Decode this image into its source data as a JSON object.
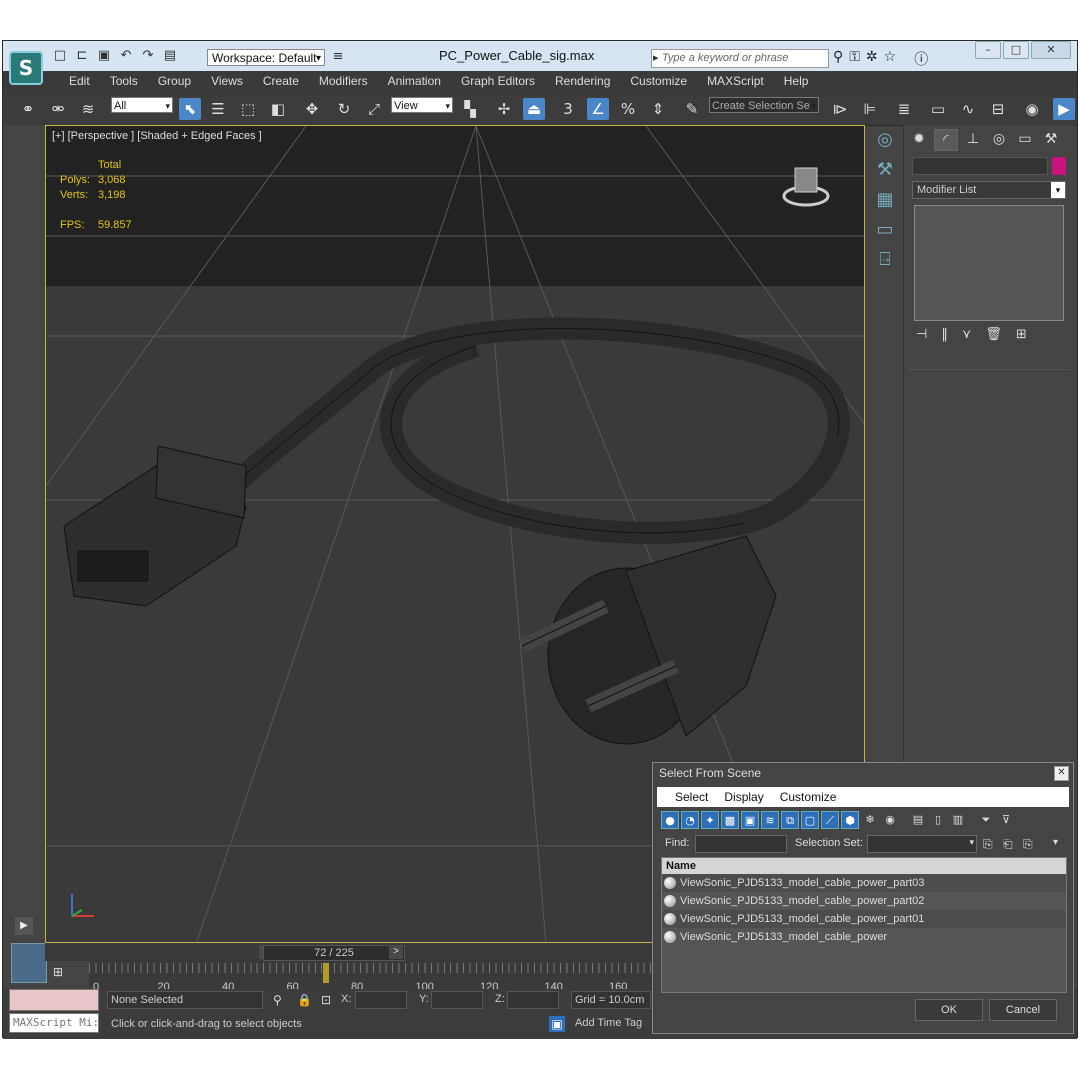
{
  "app": {
    "title": "PC_Power_Cable_sig.max",
    "workspace": "Workspace: Default",
    "search_placeholder": "Type a keyword or phrase",
    "logo_icon": "3dsmax-logo-icon"
  },
  "menu": [
    "Edit",
    "Tools",
    "Group",
    "Views",
    "Create",
    "Modifiers",
    "Animation",
    "Graph Editors",
    "Rendering",
    "Customize",
    "MAXScript",
    "Help"
  ],
  "toolbar": {
    "filter_value": "All",
    "ref_coord_value": "View",
    "named_selection_value": "Create Selection Se",
    "snap_label": "3",
    "angle_snap_label": "%"
  },
  "viewport": {
    "label": "[+] [Perspective ] [Shaded + Edged Faces ]",
    "stats": {
      "header": "Total",
      "polys_label": "Polys:",
      "polys": "3,068",
      "verts_label": "Verts:",
      "verts": "3,198",
      "fps_label": "FPS:",
      "fps": "59.857"
    }
  },
  "command_panel": {
    "modifier_list": "Modifier List",
    "color_swatch": "#c6147f"
  },
  "timeline": {
    "frame": "72 / 225",
    "ticks": [
      "0",
      "20",
      "40",
      "60",
      "80",
      "100",
      "120",
      "140",
      "160"
    ],
    "current_fraction": 0.32
  },
  "status": {
    "maxscript": "MAXScript Mi:",
    "selection": "None Selected",
    "x_label": "X:",
    "y_label": "Y:",
    "z_label": "Z:",
    "grid": "Grid = 10.0cm",
    "prompt": "Click or click-and-drag to select objects",
    "add_time_tag": "Add Time Tag"
  },
  "dialog": {
    "title": "Select From Scene",
    "menu": [
      "Select",
      "Display",
      "Customize"
    ],
    "find_label": "Find:",
    "selection_set_label": "Selection Set:",
    "column_name": "Name",
    "items": [
      "ViewSonic_PJD5133_model_cable_power_part03",
      "ViewSonic_PJD5133_model_cable_power_part02",
      "ViewSonic_PJD5133_model_cable_power_part01",
      "ViewSonic_PJD5133_model_cable_power"
    ],
    "ok": "OK",
    "cancel": "Cancel"
  }
}
